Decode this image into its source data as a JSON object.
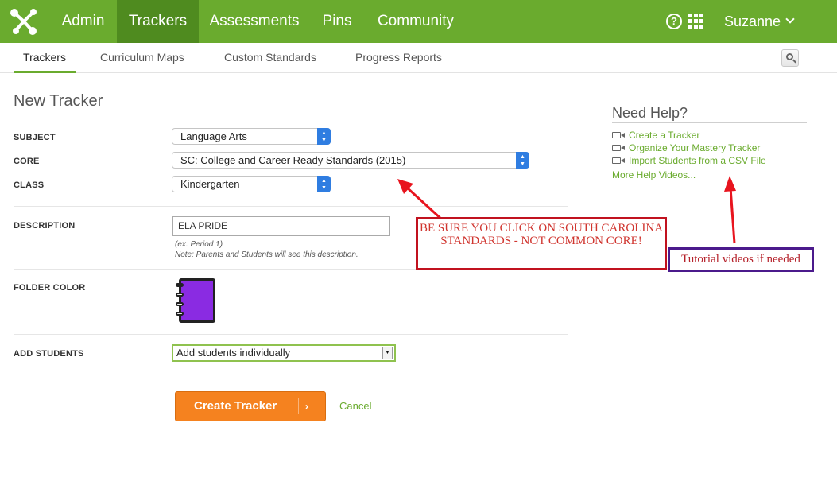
{
  "topnav": {
    "items": [
      {
        "label": "Admin"
      },
      {
        "label": "Trackers"
      },
      {
        "label": "Assessments"
      },
      {
        "label": "Pins"
      },
      {
        "label": "Community"
      }
    ],
    "user": "Suzanne"
  },
  "subnav": {
    "items": [
      {
        "label": "Trackers"
      },
      {
        "label": "Curriculum Maps"
      },
      {
        "label": "Custom Standards"
      },
      {
        "label": "Progress Reports"
      }
    ]
  },
  "form": {
    "title": "New Tracker",
    "subject": {
      "label": "SUBJECT",
      "value": "Language Arts"
    },
    "core": {
      "label": "CORE",
      "value": "SC: College and Career Ready Standards (2015)"
    },
    "class": {
      "label": "CLASS",
      "value": "Kindergarten"
    },
    "description": {
      "label": "DESCRIPTION",
      "value": "ELA PRIDE",
      "hint1": "(ex. Period 1)",
      "hint2": "Note: Parents and Students will see this description."
    },
    "folder_color": {
      "label": "FOLDER COLOR",
      "color": "#8a2be2"
    },
    "add_students": {
      "label": "ADD STUDENTS",
      "value": "Add students individually"
    },
    "create_button": "Create Tracker",
    "cancel": "Cancel"
  },
  "help": {
    "title": "Need Help?",
    "links": [
      {
        "label": "Create a Tracker"
      },
      {
        "label": "Organize Your Mastery Tracker"
      },
      {
        "label": "Import Students from a CSV File"
      }
    ],
    "more": "More Help Videos..."
  },
  "annotations": {
    "core_warning": "BE SURE YOU CLICK ON SOUTH CAROLINA STANDARDS - NOT COMMON CORE!",
    "tutorial_note": "Tutorial videos if needed"
  },
  "colors": {
    "brand_green": "#6aab2e",
    "active_green": "#4f8b1f",
    "button_orange": "#f5821f",
    "annotation_red": "#c1121f",
    "annotation_purple": "#4b1a8c"
  }
}
